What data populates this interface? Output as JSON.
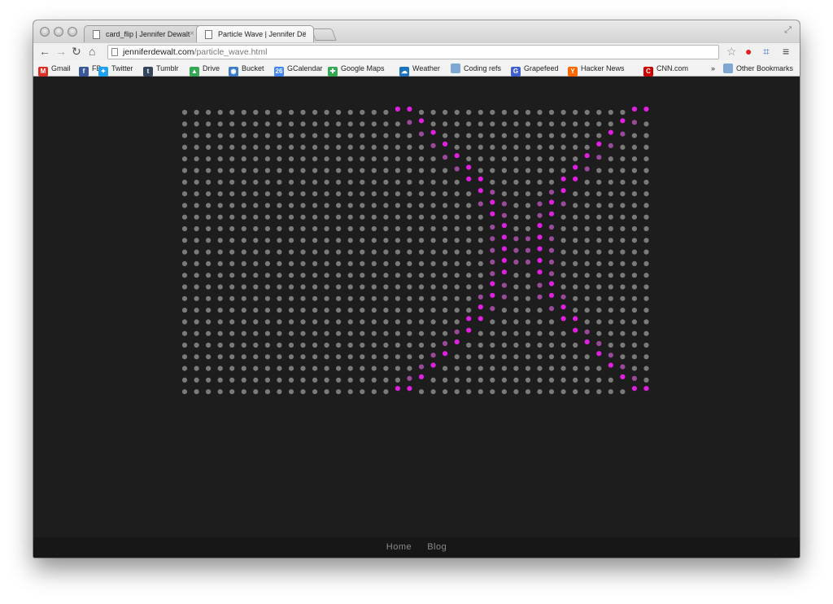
{
  "browser": {
    "tabs": [
      {
        "title": "card_flip | Jennifer Dewalt",
        "active": false
      },
      {
        "title": "Particle Wave | Jennifer De",
        "active": true
      }
    ],
    "tab_close_glyph": "×",
    "url": {
      "host": "jenniferdewalt.com",
      "path": "/particle_wave.html"
    },
    "bookmarks": [
      {
        "label": "Gmail",
        "icon": "gmail-icon",
        "color": "#d93025"
      },
      {
        "label": "FB",
        "icon": "facebook-icon",
        "color": "#3b5998"
      },
      {
        "label": "Twitter",
        "icon": "twitter-icon",
        "color": "#1da1f2"
      },
      {
        "label": "Tumblr",
        "icon": "tumblr-icon",
        "color": "#35465c"
      },
      {
        "label": "Drive",
        "icon": "drive-icon",
        "color": "#34a853"
      },
      {
        "label": "Bucket",
        "icon": "bucket-icon",
        "color": "#3e7cc7"
      },
      {
        "label": "GCalendar",
        "icon": "calendar-icon",
        "color": "#4285f4"
      },
      {
        "label": "Google Maps",
        "icon": "maps-icon",
        "color": "#34a853"
      },
      {
        "label": "Weather",
        "icon": "weather-icon",
        "color": "#1e73be"
      },
      {
        "label": "Coding refs",
        "icon": "folder-icon",
        "color": "#7fa7d4"
      },
      {
        "label": "Grapefeed",
        "icon": "grapefeed-icon",
        "color": "#4060d0"
      },
      {
        "label": "Hacker News",
        "icon": "hackernews-icon",
        "color": "#ff6600"
      },
      {
        "label": "CNN.com",
        "icon": "cnn-icon",
        "color": "#cc0000"
      }
    ],
    "bookmarks_overflow": "»",
    "other_bookmarks": "Other Bookmarks",
    "calendar_day": "26"
  },
  "page": {
    "particles": {
      "columns": 40,
      "rows": 25,
      "base_color": "#7a7a7a",
      "highlight_color": "#e020e0",
      "mid_color": "#9a4a9a"
    },
    "footer": {
      "links": [
        "Home",
        "Blog"
      ]
    }
  }
}
